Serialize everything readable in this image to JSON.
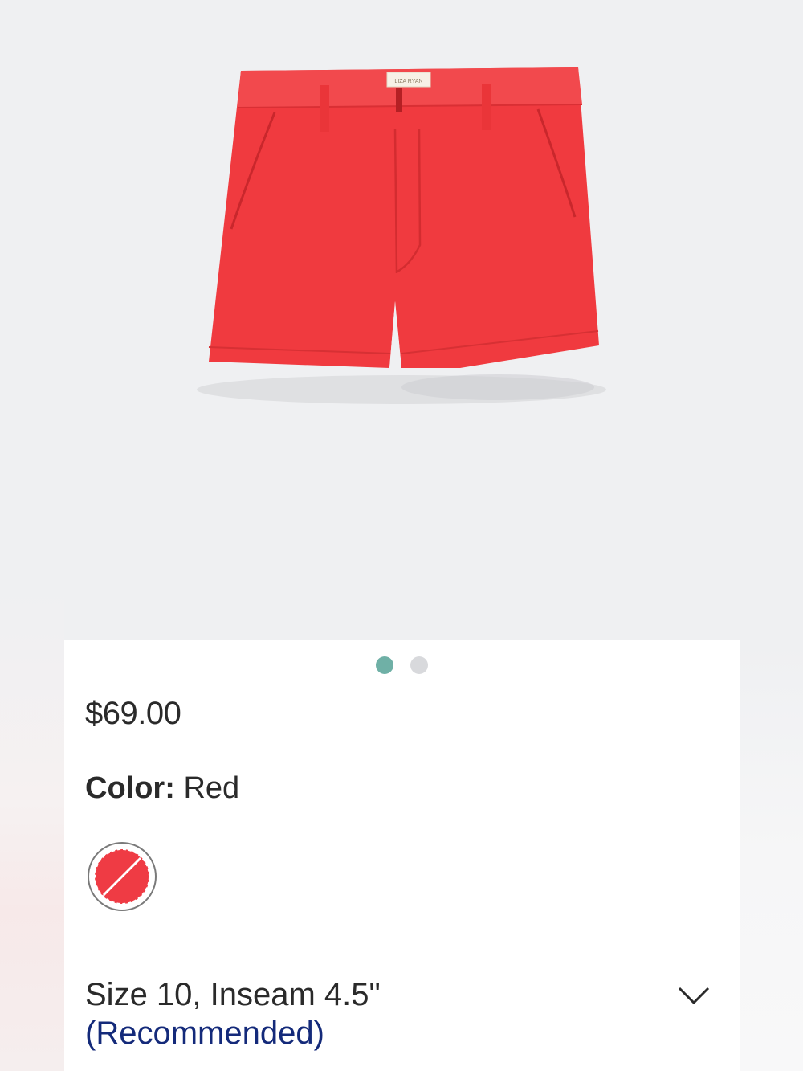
{
  "product": {
    "image_alt": "red shorts",
    "brand_tag": "LIZA RYAN",
    "image_count": 2,
    "active_image": 1
  },
  "price": "$69.00",
  "color": {
    "label": "Color:",
    "value": "Red",
    "swatch_color": "#ef3b44"
  },
  "size": {
    "value": "Size 10, Inseam 4.5\"",
    "note": "(Recommended)"
  },
  "colors": {
    "background": "#eff0f2",
    "dot_active": "#6fb0a6",
    "dot_inactive": "#d8d9dc",
    "recommended": "#142a7a",
    "shorts": "#f03a3f"
  }
}
